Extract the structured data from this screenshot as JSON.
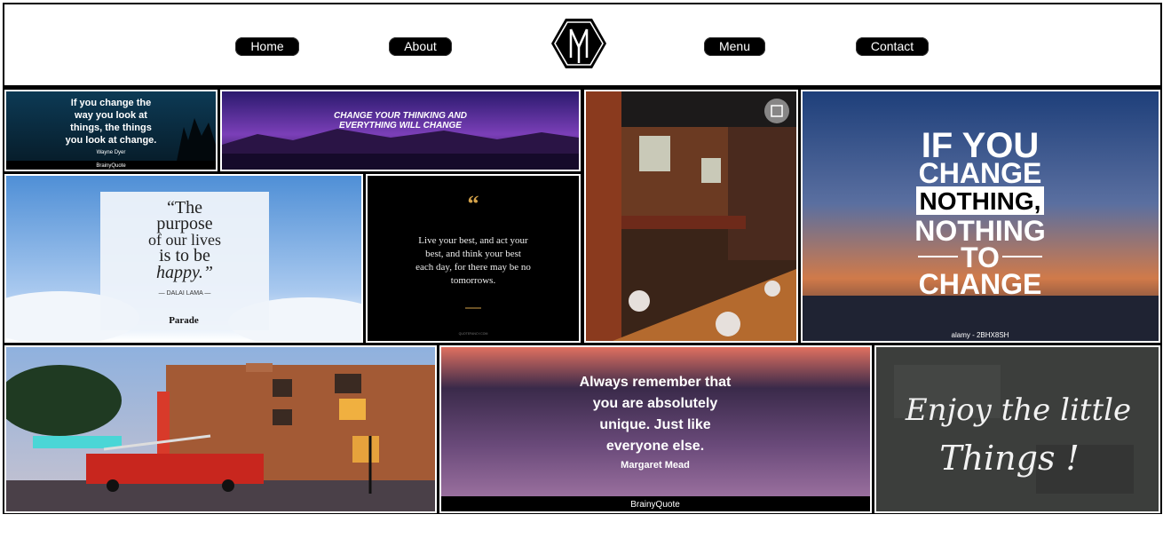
{
  "nav": {
    "home": "Home",
    "about": "About",
    "menu": "Menu",
    "contact": "Contact",
    "logo_letter": "M"
  },
  "gallery": {
    "t1": {
      "lines": [
        "If you change the",
        "way you look at",
        "things, the things",
        "you look at change."
      ],
      "author": "Wayne Dyer",
      "brand": "BrainyQuote"
    },
    "t2": {
      "lines": [
        "CHANGE YOUR THINKING AND",
        "EVERYTHING WILL CHANGE"
      ]
    },
    "t4": {
      "lines": [
        "IF YOU",
        "CHANGE",
        "NOTHING,",
        "NOTHING",
        "TO",
        "CHANGE"
      ],
      "watermark": "alamy - 2BHX8SH"
    },
    "t5": {
      "lines": [
        "“The",
        "purpose",
        "of our lives",
        "is to be",
        "happy.”"
      ],
      "author": "— DALAI LAMA —",
      "brand": "Parade"
    },
    "t6": {
      "quote_mark": "“",
      "lines": [
        "Live your best, and act your",
        "best, and think your best",
        "each day, for there may be no",
        "tomorrows."
      ],
      "source": "QUOTEFANCY.COM"
    },
    "t8": {
      "lines": [
        "Always remember that",
        "you are absolutely",
        "unique. Just like",
        "everyone else."
      ],
      "author": "Margaret Mead",
      "brand": "BrainyQuote"
    },
    "t9": {
      "lines": [
        "Enjoy the little",
        "Things !"
      ]
    }
  }
}
